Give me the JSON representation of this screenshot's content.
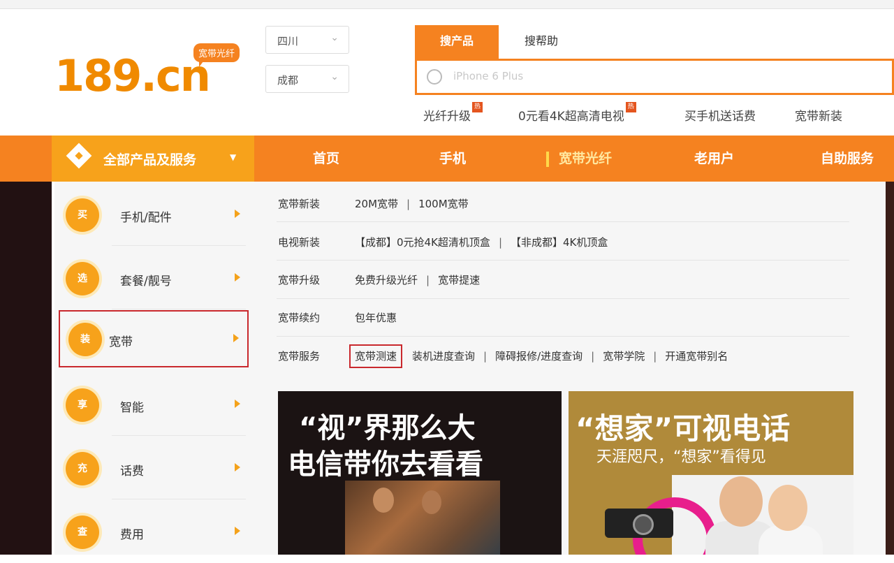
{
  "logo": {
    "text": "189.cn",
    "badge": "宽带光纤"
  },
  "region": {
    "province": "四川",
    "city": "成都"
  },
  "search": {
    "tabs": [
      "搜产品",
      "搜帮助"
    ],
    "placeholder": "iPhone 6 Plus"
  },
  "hot_links": [
    {
      "label": "光纤升级",
      "tag": "热"
    },
    {
      "label": "0元看4K超高清电视",
      "tag": "热"
    },
    {
      "label": "买手机送话费"
    },
    {
      "label": "宽带新装"
    }
  ],
  "nav": {
    "all_products": "全部产品及服务",
    "items": [
      "首页",
      "手机",
      "宽带光纤",
      "老用户",
      "自助服务"
    ]
  },
  "categories": [
    {
      "icon_text": "买",
      "label": "手机/配件"
    },
    {
      "icon_text": "选",
      "label": "套餐/靓号"
    },
    {
      "icon_text": "装",
      "label": "宽带"
    },
    {
      "icon_text": "享",
      "label": "智能"
    },
    {
      "icon_text": "充",
      "label": "话费"
    },
    {
      "icon_text": "查",
      "label": "费用"
    }
  ],
  "broadband_menu": [
    {
      "label": "宽带新装",
      "links": [
        "20M宽带",
        "100M宽带"
      ]
    },
    {
      "label": "电视新装",
      "links": [
        "【成都】0元抢4K超清机顶盒",
        "【非成都】4K机顶盒"
      ]
    },
    {
      "label": "宽带升级",
      "links": [
        "免费升级光纤",
        "宽带提速"
      ]
    },
    {
      "label": "宽带续约",
      "links": [
        "包年优惠"
      ]
    },
    {
      "label": "宽带服务",
      "links": [
        "宽带测速",
        "装机进度查询",
        "障碍报修/进度查询",
        "宽带学院",
        "开通宽带别名"
      ]
    }
  ],
  "banners": [
    {
      "line1": "“视”界那么大",
      "line2": "电信带你去看看"
    },
    {
      "line1": "“想家”可视电话",
      "line2": "天涯咫尺，“想家”看得见"
    }
  ],
  "colors": {
    "brand_orange": "#f58220",
    "nav_left": "#f7a21b",
    "highlight_red": "#c9282d"
  }
}
